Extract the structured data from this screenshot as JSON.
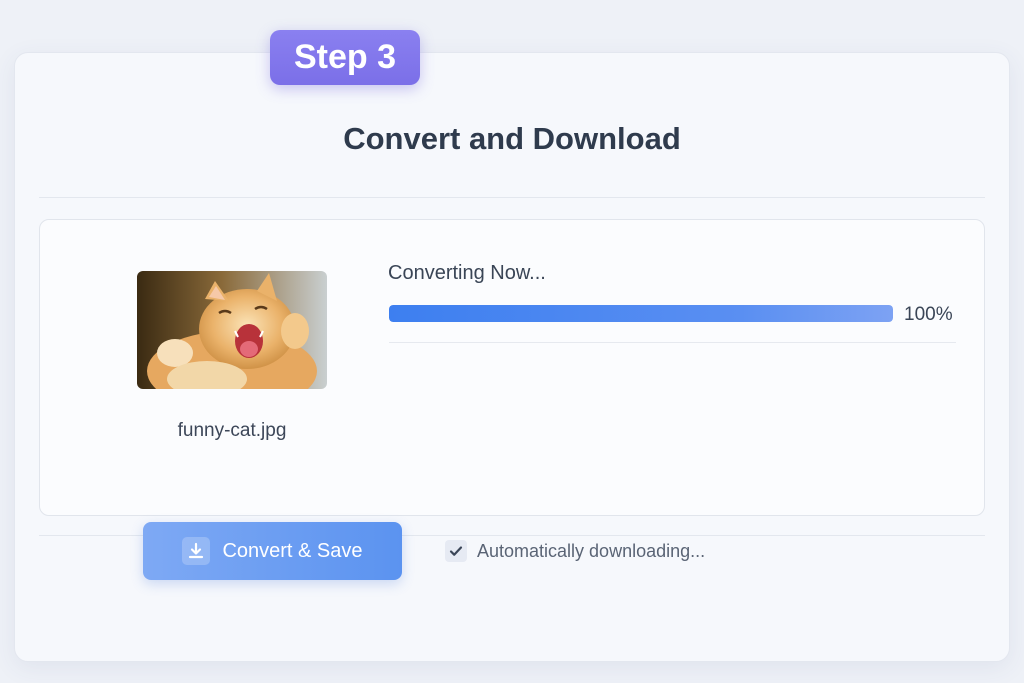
{
  "badge": {
    "text": "Step 3"
  },
  "title": "Convert and Download",
  "file": {
    "name": "funny-cat.jpg",
    "thumbnail_icon": "cat-photo"
  },
  "progress": {
    "status": "Converting Now...",
    "percent_label": "100%",
    "value": 1.0
  },
  "action": {
    "button_label": "Convert & Save",
    "button_icon": "download-icon"
  },
  "auto_download": {
    "label": "Automatically downloading...",
    "checked": true
  },
  "colors": {
    "badge": "#7b6fe8",
    "progress": "#3d7ff0",
    "button": "#5b93f0",
    "title": "#2f3b4d"
  }
}
